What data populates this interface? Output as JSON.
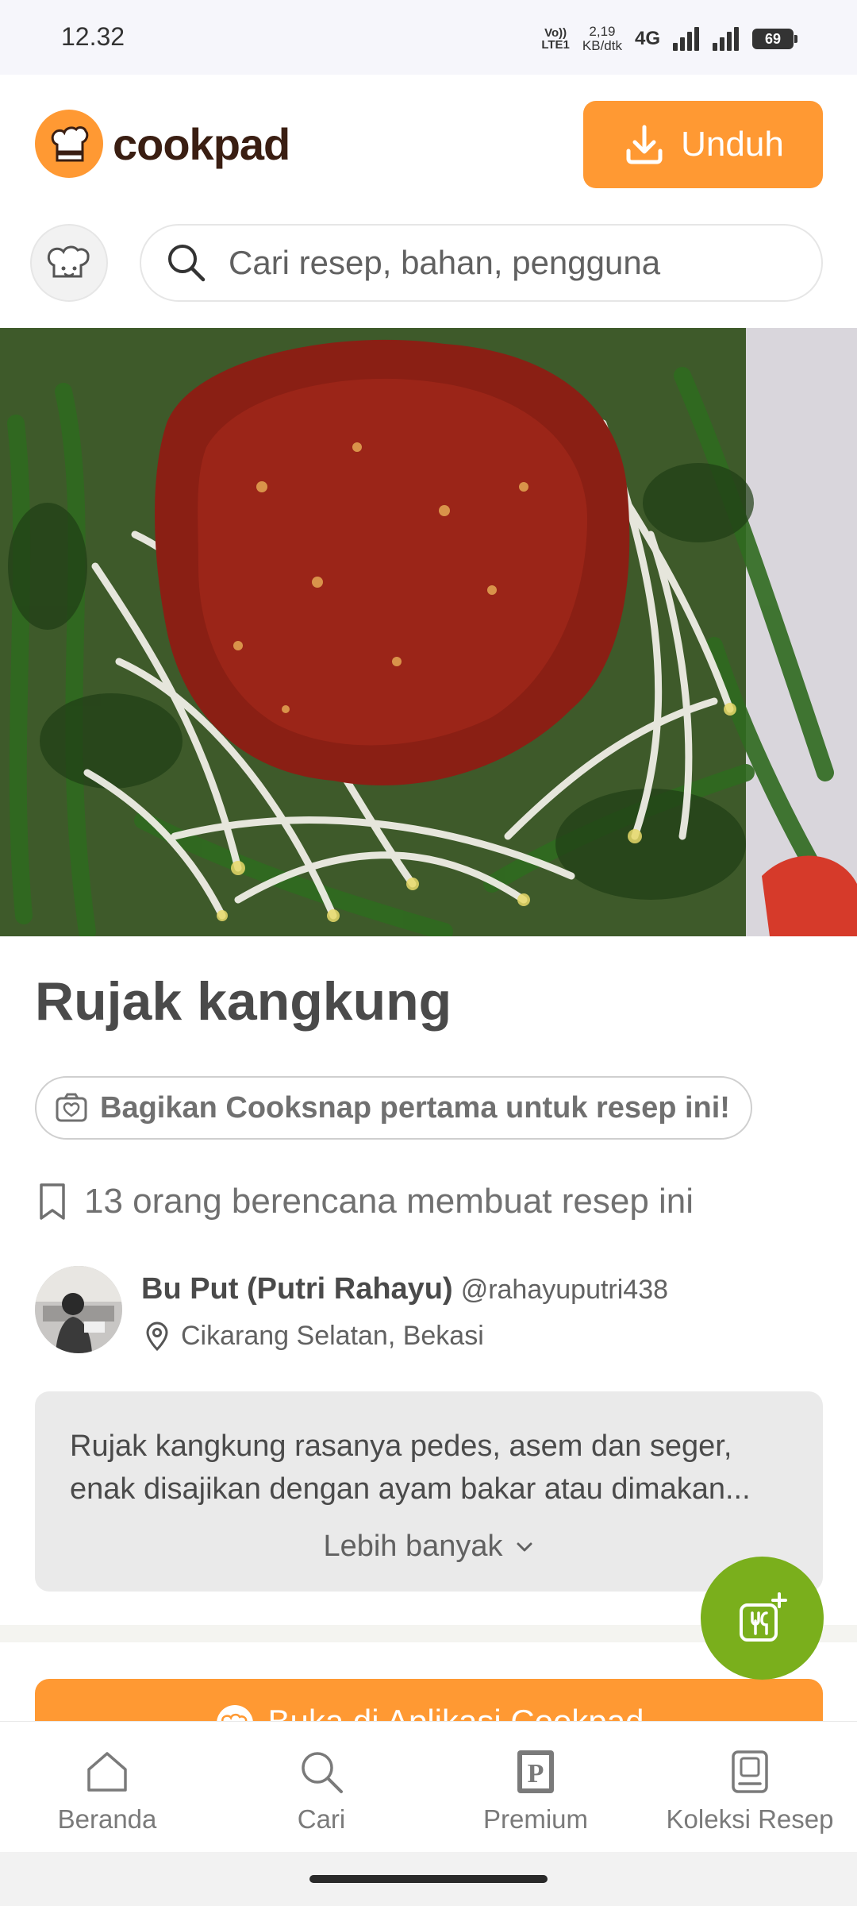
{
  "status_bar": {
    "time": "12.32",
    "volte_top": "Vo))",
    "volte_bottom": "LTE1",
    "speed_value": "2,19",
    "speed_unit": "KB/dtk",
    "network": "4G",
    "battery": "69"
  },
  "header": {
    "logo_text": "cookpad",
    "download_label": "Unduh",
    "search_placeholder": "Cari resep, bahan, pengguna"
  },
  "recipe": {
    "title": "Rujak kangkung",
    "cooksnap_cta": "Bagikan Cooksnap pertama untuk resep ini!",
    "plan_count_text": "13 orang berencana membuat resep ini",
    "author_name": "Bu Put (Putri Rahayu)",
    "author_handle": "@rahayuputri438",
    "author_location": "Cikarang Selatan, Bekasi",
    "description_line1": "Rujak kangkung rasanya pedes, asem dan seger,",
    "description_line2": "enak disajikan dengan ayam bakar atau dimakan...",
    "more_label": "Lebih banyak",
    "open_app_label": "Buka di Aplikasi Cookpad"
  },
  "bottom_nav": {
    "items": [
      {
        "label": "Beranda",
        "icon": "home-icon"
      },
      {
        "label": "Cari",
        "icon": "search-icon"
      },
      {
        "label": "Premium",
        "icon": "premium-icon"
      },
      {
        "label": "Koleksi Resep",
        "icon": "recipe-collection-icon"
      }
    ]
  },
  "colors": {
    "brand_orange": "#ff9933",
    "fab_green": "#7aaf1c",
    "text_dark": "#4a4a4a"
  }
}
